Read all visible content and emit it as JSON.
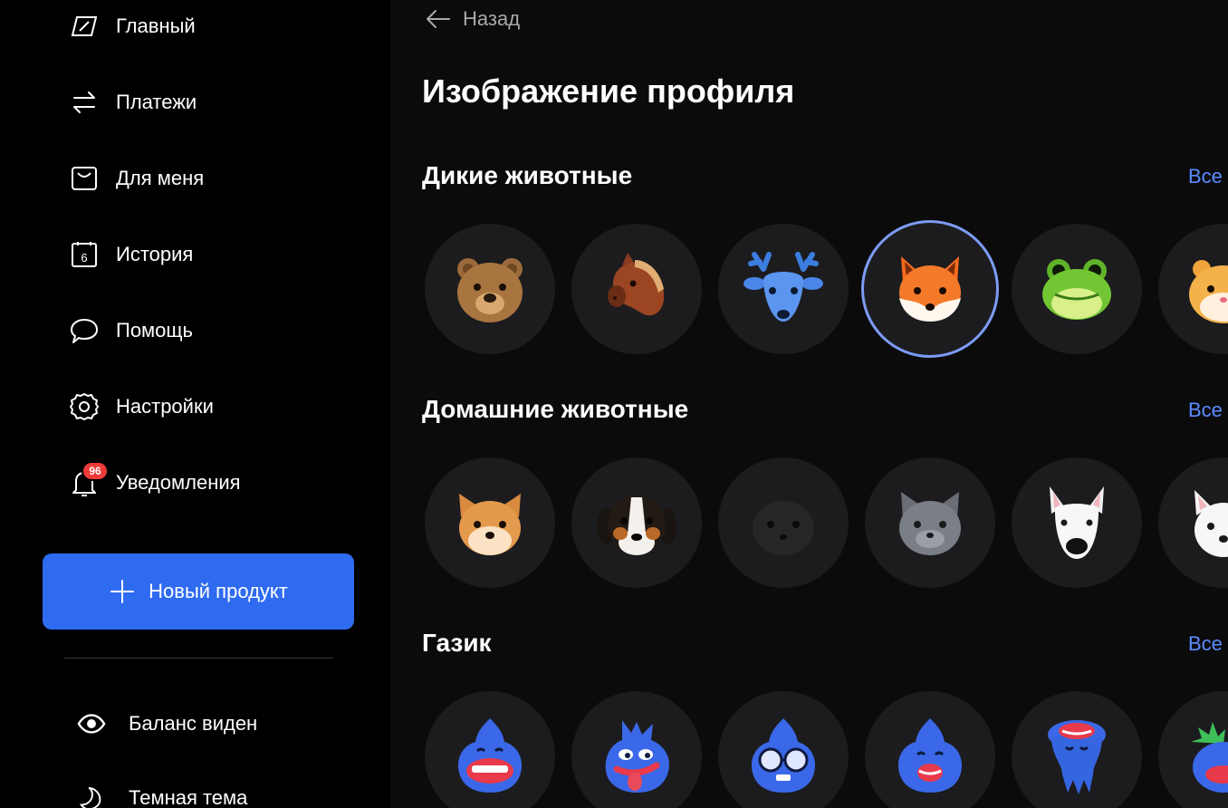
{
  "sidebar": {
    "nav": [
      {
        "label": "Главный",
        "icon": "home-card-icon"
      },
      {
        "label": "Платежи",
        "icon": "transfer-arrows-icon"
      },
      {
        "label": "Для меня",
        "icon": "shopping-bag-icon"
      },
      {
        "label": "История",
        "icon": "calendar-icon",
        "icon_text": "6"
      },
      {
        "label": "Помощь",
        "icon": "chat-bubble-icon"
      },
      {
        "label": "Настройки",
        "icon": "gear-icon"
      },
      {
        "label": "Уведомления",
        "icon": "bell-icon",
        "badge": "96"
      }
    ],
    "new_product_label": "Новый продукт",
    "toggles": [
      {
        "label": "Баланс виден",
        "icon": "eye-icon"
      },
      {
        "label": "Темная тема",
        "icon": "moon-icon"
      }
    ]
  },
  "main": {
    "back_label": "Назад",
    "title": "Изображение профиля",
    "sections": [
      {
        "title": "Дикие животные",
        "see_all": "Все",
        "avatars": [
          "bear-avatar-icon",
          "horse-avatar-icon",
          "deer-avatar-icon",
          "fox-avatar-icon",
          "frog-avatar-icon",
          "hamster-avatar-icon"
        ],
        "selected_index": 3
      },
      {
        "title": "Домашние животные",
        "see_all": "Все",
        "avatars": [
          "shiba-avatar-icon",
          "bernese-dog-avatar-icon",
          "black-cat-avatar-icon",
          "gray-cat-avatar-icon",
          "bull-terrier-avatar-icon",
          "white-dog-avatar-icon"
        ]
      },
      {
        "title": "Газик",
        "see_all": "Все",
        "avatars": [
          "gazik-smile-avatar-icon",
          "gazik-tongue-avatar-icon",
          "gazik-glasses-avatar-icon",
          "gazik-happy-avatar-icon",
          "gazik-upside-down-avatar-icon",
          "gazik-spiky-avatar-icon"
        ]
      }
    ]
  },
  "colors": {
    "accent": "#2f6bf0",
    "link": "#5b8cff",
    "badge": "#ef3a3a",
    "selected_ring": "#7d9cf5"
  }
}
